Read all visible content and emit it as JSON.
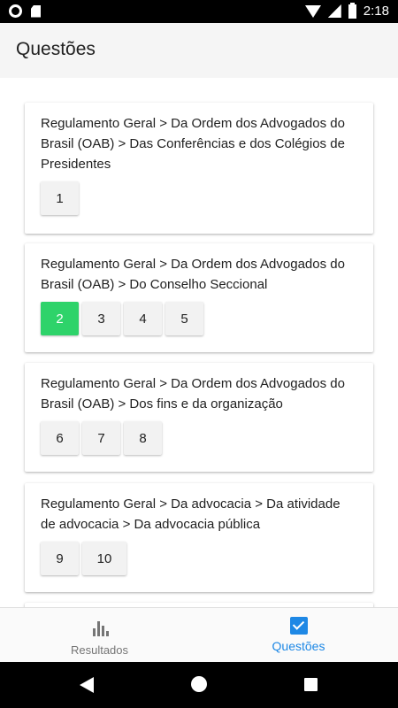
{
  "status_bar": {
    "time": "2:18",
    "icons": [
      "circle-icon",
      "sd-card-icon",
      "wifi-icon",
      "signal-icon",
      "battery-charging-icon"
    ]
  },
  "app_bar": {
    "title": "Questões"
  },
  "groups": [
    {
      "path": "Regulamento Geral > Da Ordem dos Advogados do Brasil (OAB) > Das Conferências e dos Colégios de Presidentes",
      "questions": [
        "1"
      ]
    },
    {
      "path": "Regulamento Geral > Da Ordem dos Advogados do Brasil (OAB) > Do Conselho Seccional",
      "questions": [
        "2",
        "3",
        "4",
        "5"
      ],
      "active": "2"
    },
    {
      "path": "Regulamento Geral > Da Ordem dos Advogados do Brasil (OAB) > Dos fins e da organização",
      "questions": [
        "6",
        "7",
        "8"
      ]
    },
    {
      "path": "Regulamento Geral > Da advocacia > Da atividade de advocacia > Da advocacia pública",
      "questions": [
        "9",
        "10"
      ]
    }
  ],
  "bottom_nav": {
    "results_label": "Resultados",
    "questions_label": "Questões",
    "active_color": "#1e88e5"
  },
  "colors": {
    "active_question": "#2ed36a"
  }
}
